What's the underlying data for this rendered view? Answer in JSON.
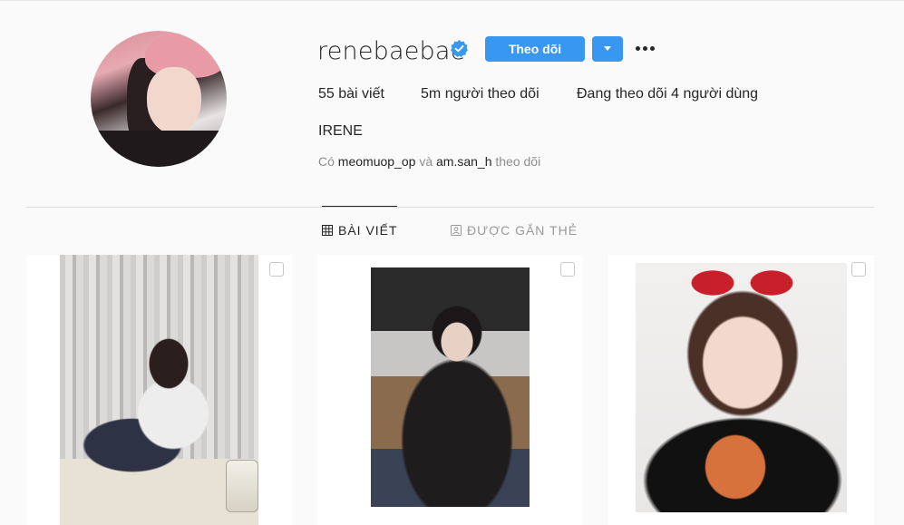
{
  "profile": {
    "username": "renebaebae",
    "verified_icon": "verified-badge-icon",
    "full_name": "IRENE",
    "followed_by": {
      "prefix": "Có",
      "user1": "meomuop_op",
      "conj": "và",
      "user2": "am.san_h",
      "suffix": "theo dõi"
    }
  },
  "actions": {
    "follow_label": "Theo dõi",
    "dropdown_icon": "caret-down-icon",
    "more_icon": "ellipsis-icon"
  },
  "stats": {
    "posts_count": "55",
    "posts_label": "bài viết",
    "followers_count": "5m",
    "followers_label": "người theo dõi",
    "following_prefix": "Đang theo dõi",
    "following_count": "4",
    "following_label": "người dùng"
  },
  "tabs": [
    {
      "label": "BÀI VIẾT",
      "icon": "grid-icon",
      "active": true
    },
    {
      "label": "ĐƯỢC GẮN THẺ",
      "icon": "tagged-icon",
      "active": false
    }
  ],
  "colors": {
    "accent": "#3897f0",
    "background": "#fafafa",
    "text": "#262626",
    "muted": "#8e8e8e"
  }
}
